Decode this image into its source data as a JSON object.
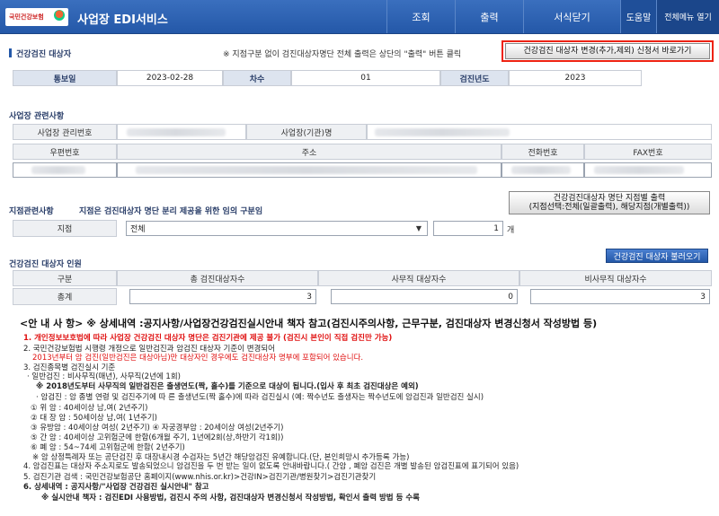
{
  "header": {
    "logo_text": "국민건강보험",
    "app_title": "사업장 EDI서비스",
    "menu": [
      "조회",
      "출력",
      "서식닫기",
      "도움말",
      "전체메뉴 열기"
    ]
  },
  "section1": {
    "title": "건강검진 대상자",
    "note": "※ 지점구분 없이 검진대상자명단 전체 출력은 상단의 \"출력\" 버튼 클릭",
    "change_button": "건강검진 대상자 변경(추가,제외) 신청서 바로가기",
    "labels": {
      "notice_day": "통보일",
      "round": "차수",
      "year": "검진년도"
    },
    "values": {
      "notice_day": "2023-02-28",
      "round": "01",
      "year": "2023"
    }
  },
  "workplace": {
    "title": "사업장 관련사항",
    "labels": {
      "mgmt_no": "사업장 관리번호",
      "name": "사업장(기관)명",
      "zip": "우편번호",
      "address": "주소",
      "phone": "전화번호",
      "fax": "FAX번호"
    }
  },
  "branch": {
    "title": "지점관련사항",
    "desc": "지점은 검진대상자 명단 분리 제공을 위한 임의 구분임",
    "print_button_line1": "건강검진대상자 명단 지점별 출력",
    "print_button_line2": "(지점선택:전체(일괄출력), 해당지점(개별출력))",
    "label": "지점",
    "selected": "전체",
    "count": "1",
    "count_unit": "개"
  },
  "personnel": {
    "title": "건강검진 대상자 인원",
    "load_button": "건강검진 대상자 불러오기",
    "headers": [
      "구분",
      "총 검진대상자수",
      "사무직 대상자수",
      "비사무직 대상자수"
    ],
    "row_label": "총계",
    "values": [
      "3",
      "0",
      "3"
    ]
  },
  "notice": {
    "head": "<안 내 사 항> ※ 상세내역 :공지사항/사업장건강검진실시안내 책자 참고(검진시주의사항, 근무구분, 검진대상자 변경신청서 작성방법 등)",
    "lines": [
      "1. 개인정보보호법에 따라 사업장 건강검진 대상자 명단은 검진기관에 제공 불가 (검진시 본인이 직접 검진만 가능)",
      "2. 국민건강보험법 시행령 개정으로 일반검진과 암검진 대상자 기준이 변경되어",
      "2013년부터 암 검진(일반검진은 대상아님)만 대상자인 경우에도 검진대상자 명부에 포함되어 있습니다.",
      "3. 검진종목별 검진실시 기준",
      "· 일반검진 : 비사무직(매년), 사무직(2년에 1회)",
      "※ 2018년도부터 사무직의 일반검진은 출생연도(짝, 홀수)를 기준으로 대상이 됩니다.(입사 후 최초 검진대상은 예외)",
      "· 암검진 : 암 종별 연령 및 검진주기에 따 른 출생년도(짝 홀수)에 따라 검진실시 (예: 짝수년도 출생자는 짝수년도에 암검진과 일반검진 실시)",
      "① 위    암 : 40세이상 남,여( 2년주기)",
      "② 대   장 암 : 50세이상 남,여( 1년주기)",
      "③ 유방암 : 40세이상 여성( 2년주기)     ④ 자궁경부암 : 20세이상 여성(2년주기)",
      "⑤ 간    암 : 40세이상 고위험군에 한함(6개월 주기, 1년에2회(상,하반기 각1회))",
      "⑥ 폐    암 : 54~74세 고위험군에 한함( 2년주기)",
      "※ 암 상정특례자 또는 공단검진 후 대장내시경 수검자는 5년간 해당암검진 유예합니다.(단, 본인희망시 추가등록 가능)",
      "4. 암검진표는 대상자 주소지로도 발송되었으니 암검진을 두 번 받는 일이 없도록 안내바랍니다.( 간암 , 폐암 검진은 개별 발송된  암검진표에 표기되어 있음)",
      "5. 검진기관 검색 : 국민건강보험공단 홈페이지(www.nhis.or.kr)>건강IN>검진기관/병원찾기>검진기관찾기",
      "6. 상세내역 :  공지사항/\"사업장 건강검진 실시안내\" 참고",
      "※ 실시안내 책자 :  검진EDI 사용방법, 검진시 주의 사항, 검진대상자 변경신청서 작성방법, 확인서 출력 방법 등 수록"
    ]
  }
}
